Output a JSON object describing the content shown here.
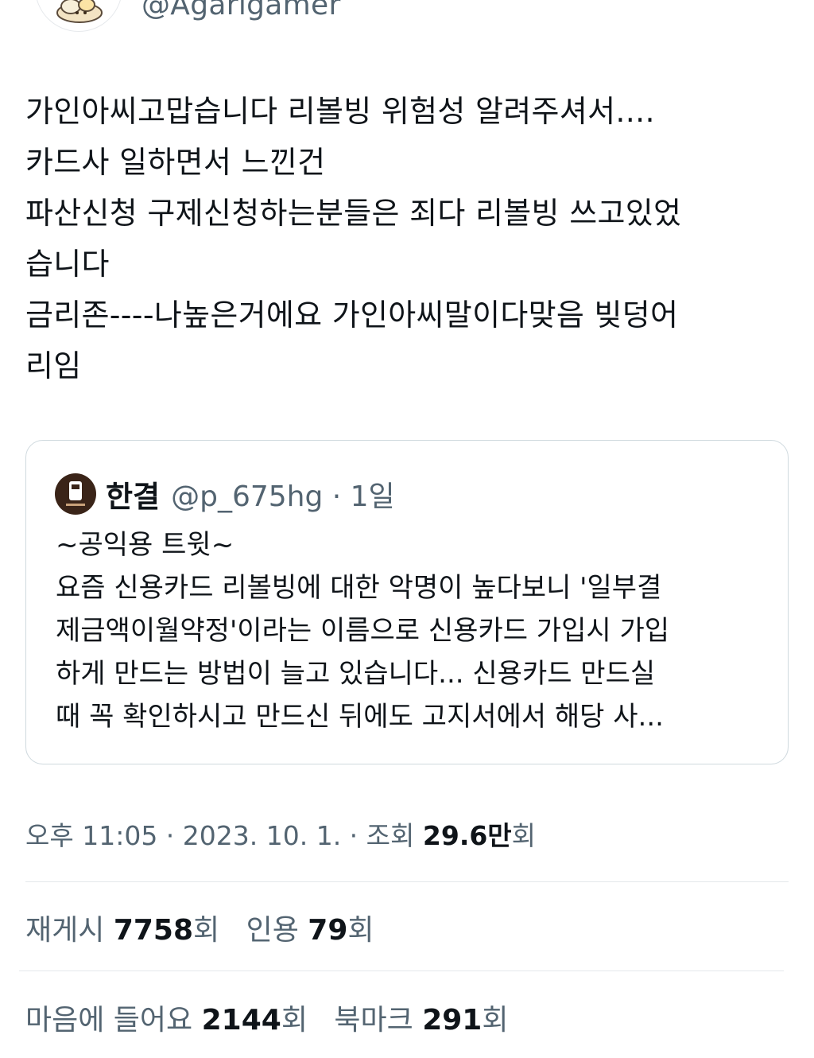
{
  "author": {
    "handle": "@Agarigamer"
  },
  "tweet": {
    "lines": [
      "가인아씨고맙습니다 리볼빙 위험성 알려주셔서....",
      "카드사 일하면서 느낀건",
      "파산신청 구제신청하는분들은 죄다 리볼빙 쓰고있었",
      "습니다",
      "금리존----나높은거에요 가인아씨말이다맞음 빚덩어",
      "리임"
    ]
  },
  "quote": {
    "name": "한결",
    "handle_time": "@p_675hg · 1일",
    "lines": [
      "~공익용 트윗~",
      "요즘 신용카드 리볼빙에 대한 악명이 높다보니 '일부결",
      "제금액이월약정'이라는 이름으로 신용카드 가입시 가입",
      "하게 만드는 방법이 늘고 있습니다... 신용카드 만드실",
      "때 꼭 확인하시고 만드신 뒤에도 고지서에서 해당 사..."
    ]
  },
  "meta": {
    "time": "오후 11:05 · 2023. 10. 1. · 조회 ",
    "views": "29.6만",
    "views_unit": "회"
  },
  "stats": {
    "retweets_label": "재게시 ",
    "retweets": "7758",
    "retweets_unit": "회",
    "quotes_label": "인용 ",
    "quotes": "79",
    "quotes_unit": "회",
    "likes_label": "마음에 들어요 ",
    "likes": "2144",
    "likes_unit": "회",
    "bookmarks_label": "북마크 ",
    "bookmarks": "291",
    "bookmarks_unit": "회"
  },
  "colors": {
    "text": "#0f1419",
    "secondary": "#536471",
    "border": "#cfd9de"
  },
  "icons": {
    "author_avatar": "cloud-bread-avatar-icon",
    "quote_avatar": "cafe-logo-avatar-icon"
  }
}
